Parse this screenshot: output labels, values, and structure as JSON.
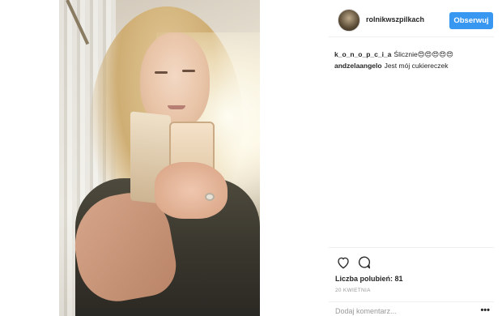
{
  "post": {
    "username": "rolnikwszpilkach",
    "follow_label": "Obserwuj"
  },
  "comments": [
    {
      "user": "k_o_n_o_p_c_i_a",
      "text": "Ślicznie😍😍😍😍😍"
    },
    {
      "user": "andzelaangelo",
      "text": "Jest mój cukiereczek"
    }
  ],
  "footer": {
    "likes": "Liczba polubień: 81",
    "date": "20 KWIETNIA",
    "comment_placeholder": "Dodaj komentarz...",
    "more_label": "•••"
  },
  "icons": {
    "like": "heart-icon",
    "comment": "comment-bubble-icon",
    "more": "more-options-icon"
  },
  "colors": {
    "accent": "#3897f0",
    "text": "#262626",
    "muted": "#999999",
    "divider": "#efefef"
  }
}
